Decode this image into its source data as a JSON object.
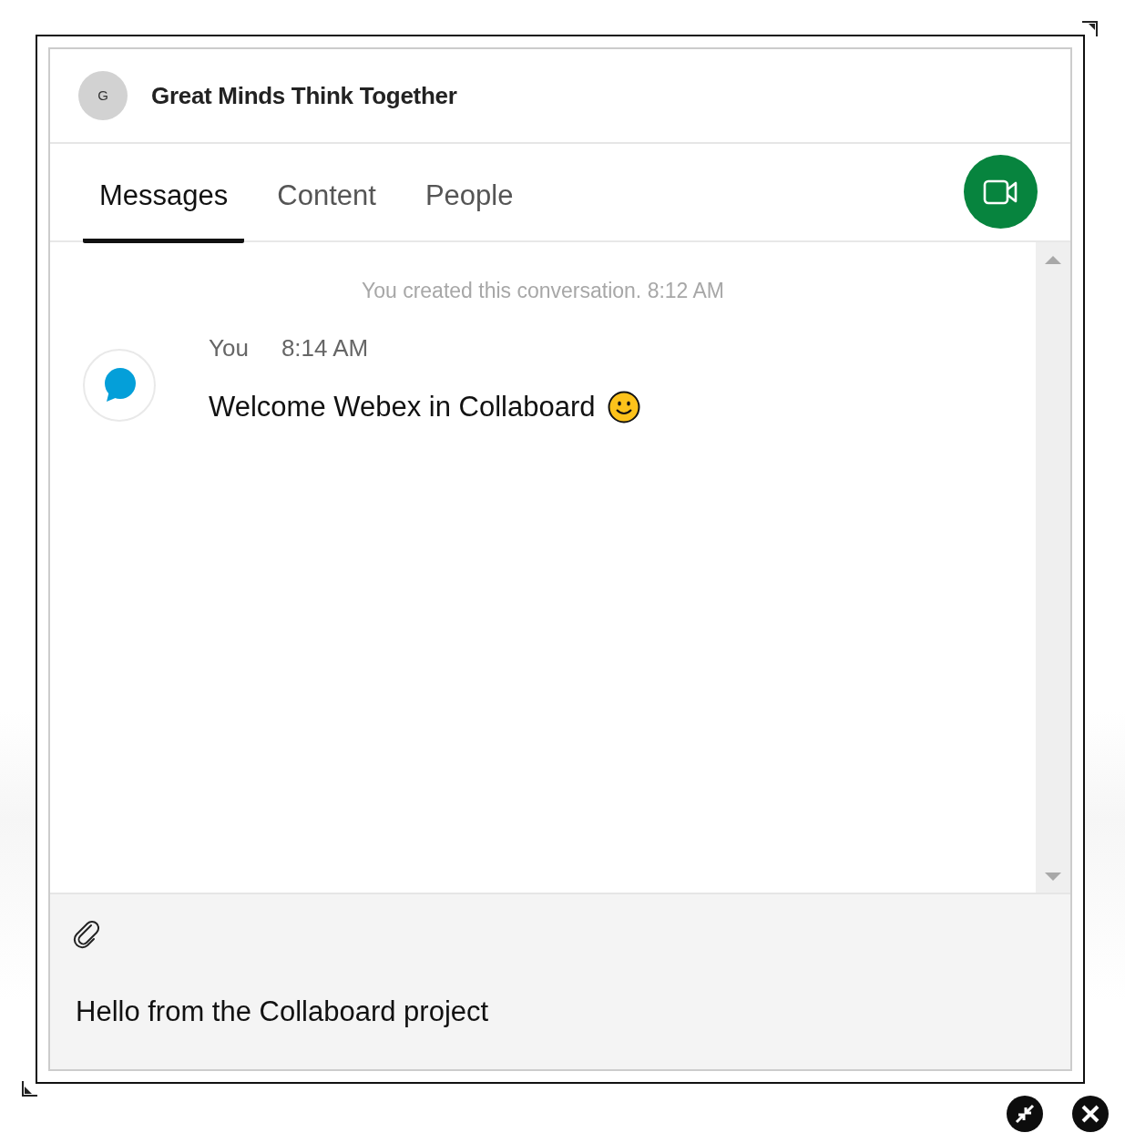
{
  "header": {
    "avatar_initial": "G",
    "title": "Great Minds Think Together"
  },
  "tabs": [
    {
      "label": "Messages",
      "selected": true
    },
    {
      "label": "Content",
      "selected": false
    },
    {
      "label": "People",
      "selected": false
    }
  ],
  "messages": [
    {
      "kind": "system",
      "text": "You created this conversation. 8:12 AM"
    },
    {
      "kind": "message",
      "sender": "You",
      "time": "8:14 AM",
      "text": "Welcome Webex in Collaboard"
    }
  ],
  "composer": {
    "value": "Hello from the Collaboard project"
  }
}
